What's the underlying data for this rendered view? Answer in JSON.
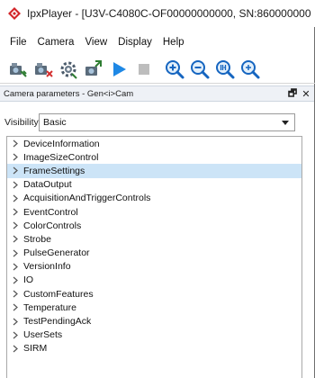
{
  "window": {
    "title": "IpxPlayer - [U3V-C4080C-OF00000000000, SN:860000000"
  },
  "menu": [
    {
      "label": "File"
    },
    {
      "label": "Camera"
    },
    {
      "label": "View"
    },
    {
      "label": "Display"
    },
    {
      "label": "Help"
    }
  ],
  "toolbar": {
    "buttons": [
      {
        "icon": "connect-camera-icon"
      },
      {
        "icon": "disconnect-camera-icon"
      },
      {
        "icon": "camera-settings-icon"
      },
      {
        "icon": "save-settings-icon"
      },
      {
        "icon": "play-icon"
      },
      {
        "icon": "stop-icon"
      },
      {
        "icon": "zoom-in-icon"
      },
      {
        "icon": "zoom-out-icon"
      },
      {
        "icon": "zoom-fit-icon"
      },
      {
        "icon": "zoom-actual-icon"
      }
    ]
  },
  "panel": {
    "title": "Camera parameters - Gen<i>Cam",
    "float_glyph": "🗗",
    "close_glyph": "✕"
  },
  "visibility": {
    "label": "Visibility:",
    "value": "Basic"
  },
  "tree": {
    "selected_index": 2,
    "items": [
      {
        "label": "DeviceInformation"
      },
      {
        "label": "ImageSizeControl"
      },
      {
        "label": "FrameSettings"
      },
      {
        "label": "DataOutput"
      },
      {
        "label": "AcquisitionAndTriggerControls"
      },
      {
        "label": "EventControl"
      },
      {
        "label": "ColorControls"
      },
      {
        "label": "Strobe"
      },
      {
        "label": "PulseGenerator"
      },
      {
        "label": "VersionInfo"
      },
      {
        "label": "IO"
      },
      {
        "label": "CustomFeatures"
      },
      {
        "label": "Temperature"
      },
      {
        "label": "TestPendingAck"
      },
      {
        "label": "UserSets"
      },
      {
        "label": "SIRM"
      }
    ]
  },
  "colors": {
    "selection": "#cce4f7",
    "panel_header": "#eef1f6",
    "play": "#1e88e5",
    "app_icon": "#d3262a"
  }
}
